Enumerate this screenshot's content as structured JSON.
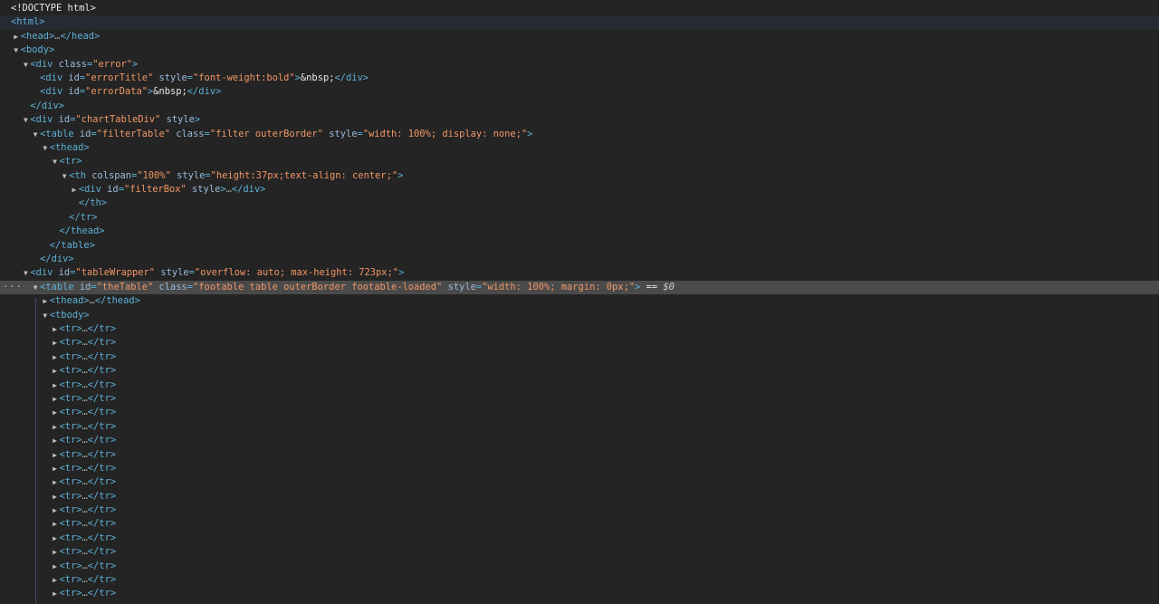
{
  "panel": {
    "name": "Elements"
  },
  "lines": [
    {
      "depth": 0,
      "toggle": "none",
      "segments": [
        {
          "t": "<!DOCTYPE html>",
          "c": "txt"
        }
      ]
    },
    {
      "depth": 0,
      "toggle": "none",
      "row": "hover",
      "segments": [
        {
          "t": "<html>",
          "c": "tag"
        }
      ]
    },
    {
      "depth": 1,
      "toggle": "collapsed",
      "segments": [
        {
          "t": "<head>",
          "c": "tag"
        },
        {
          "t": "…",
          "c": "ell"
        },
        {
          "t": "</head>",
          "c": "tag"
        }
      ]
    },
    {
      "depth": 1,
      "toggle": "expanded",
      "segments": [
        {
          "t": "<body>",
          "c": "tag"
        }
      ]
    },
    {
      "depth": 2,
      "toggle": "expanded",
      "segments": [
        {
          "t": "<div ",
          "c": "tag"
        },
        {
          "t": "class",
          "c": "attr"
        },
        {
          "t": "=",
          "c": "tag"
        },
        {
          "t": "\"error\"",
          "c": "val"
        },
        {
          "t": ">",
          "c": "tag"
        }
      ]
    },
    {
      "depth": 3,
      "toggle": "none",
      "segments": [
        {
          "t": "<div ",
          "c": "tag"
        },
        {
          "t": "id",
          "c": "attr"
        },
        {
          "t": "=",
          "c": "tag"
        },
        {
          "t": "\"errorTitle\"",
          "c": "val"
        },
        {
          "t": " ",
          "c": "tag"
        },
        {
          "t": "style",
          "c": "attr"
        },
        {
          "t": "=",
          "c": "tag"
        },
        {
          "t": "\"font-weight:bold\"",
          "c": "val"
        },
        {
          "t": ">",
          "c": "tag"
        },
        {
          "t": "&nbsp;",
          "c": "txt"
        },
        {
          "t": "</div>",
          "c": "tag"
        }
      ]
    },
    {
      "depth": 3,
      "toggle": "none",
      "segments": [
        {
          "t": "<div ",
          "c": "tag"
        },
        {
          "t": "id",
          "c": "attr"
        },
        {
          "t": "=",
          "c": "tag"
        },
        {
          "t": "\"errorData\"",
          "c": "val"
        },
        {
          "t": ">",
          "c": "tag"
        },
        {
          "t": "&nbsp;",
          "c": "txt"
        },
        {
          "t": "</div>",
          "c": "tag"
        }
      ]
    },
    {
      "depth": 2,
      "toggle": "none",
      "segments": [
        {
          "t": "</div>",
          "c": "tag"
        }
      ]
    },
    {
      "depth": 2,
      "toggle": "expanded",
      "segments": [
        {
          "t": "<div ",
          "c": "tag"
        },
        {
          "t": "id",
          "c": "attr"
        },
        {
          "t": "=",
          "c": "tag"
        },
        {
          "t": "\"chartTableDiv\"",
          "c": "val"
        },
        {
          "t": " ",
          "c": "tag"
        },
        {
          "t": "style",
          "c": "attr"
        },
        {
          "t": ">",
          "c": "tag"
        }
      ]
    },
    {
      "depth": 3,
      "toggle": "expanded",
      "segments": [
        {
          "t": "<table ",
          "c": "tag"
        },
        {
          "t": "id",
          "c": "attr"
        },
        {
          "t": "=",
          "c": "tag"
        },
        {
          "t": "\"filterTable\"",
          "c": "val"
        },
        {
          "t": " ",
          "c": "tag"
        },
        {
          "t": "class",
          "c": "attr"
        },
        {
          "t": "=",
          "c": "tag"
        },
        {
          "t": "\"filter outerBorder\"",
          "c": "val"
        },
        {
          "t": " ",
          "c": "tag"
        },
        {
          "t": "style",
          "c": "attr"
        },
        {
          "t": "=",
          "c": "tag"
        },
        {
          "t": "\"width: 100%; display: none;\"",
          "c": "val"
        },
        {
          "t": ">",
          "c": "tag"
        }
      ]
    },
    {
      "depth": 4,
      "toggle": "expanded",
      "segments": [
        {
          "t": "<thead>",
          "c": "tag"
        }
      ]
    },
    {
      "depth": 5,
      "toggle": "expanded",
      "segments": [
        {
          "t": "<tr>",
          "c": "tag"
        }
      ]
    },
    {
      "depth": 6,
      "toggle": "expanded",
      "segments": [
        {
          "t": "<th ",
          "c": "tag"
        },
        {
          "t": "colspan",
          "c": "attr"
        },
        {
          "t": "=",
          "c": "tag"
        },
        {
          "t": "\"100%\"",
          "c": "val"
        },
        {
          "t": " ",
          "c": "tag"
        },
        {
          "t": "style",
          "c": "attr"
        },
        {
          "t": "=",
          "c": "tag"
        },
        {
          "t": "\"height:37px;text-align: center;\"",
          "c": "val"
        },
        {
          "t": ">",
          "c": "tag"
        }
      ]
    },
    {
      "depth": 7,
      "toggle": "collapsed",
      "segments": [
        {
          "t": "<div ",
          "c": "tag"
        },
        {
          "t": "id",
          "c": "attr"
        },
        {
          "t": "=",
          "c": "tag"
        },
        {
          "t": "\"filterBox\"",
          "c": "val"
        },
        {
          "t": " ",
          "c": "tag"
        },
        {
          "t": "style",
          "c": "attr"
        },
        {
          "t": ">",
          "c": "tag"
        },
        {
          "t": "…",
          "c": "ell"
        },
        {
          "t": "</div>",
          "c": "tag"
        }
      ]
    },
    {
      "depth": 7,
      "toggle": "none",
      "segments": [
        {
          "t": "</th>",
          "c": "tag"
        }
      ]
    },
    {
      "depth": 6,
      "toggle": "none",
      "segments": [
        {
          "t": "</tr>",
          "c": "tag"
        }
      ]
    },
    {
      "depth": 5,
      "toggle": "none",
      "segments": [
        {
          "t": "</thead>",
          "c": "tag"
        }
      ]
    },
    {
      "depth": 4,
      "toggle": "none",
      "segments": [
        {
          "t": "</table>",
          "c": "tag"
        }
      ]
    },
    {
      "depth": 3,
      "toggle": "none",
      "segments": [
        {
          "t": "</div>",
          "c": "tag"
        }
      ]
    },
    {
      "depth": 2,
      "toggle": "expanded",
      "segments": [
        {
          "t": "<div ",
          "c": "tag"
        },
        {
          "t": "id",
          "c": "attr"
        },
        {
          "t": "=",
          "c": "tag"
        },
        {
          "t": "\"tableWrapper\"",
          "c": "val"
        },
        {
          "t": " ",
          "c": "tag"
        },
        {
          "t": "style",
          "c": "attr"
        },
        {
          "t": "=",
          "c": "tag"
        },
        {
          "t": "\"overflow: auto; max-height: 723px;\"",
          "c": "val"
        },
        {
          "t": ">",
          "c": "tag"
        }
      ]
    },
    {
      "depth": 3,
      "toggle": "expanded",
      "row": "selected",
      "dots": "···",
      "segments": [
        {
          "t": "<table ",
          "c": "tag"
        },
        {
          "t": "id",
          "c": "attr"
        },
        {
          "t": "=",
          "c": "tag"
        },
        {
          "t": "\"theTable\"",
          "c": "val"
        },
        {
          "t": " ",
          "c": "tag"
        },
        {
          "t": "class",
          "c": "attr"
        },
        {
          "t": "=",
          "c": "tag"
        },
        {
          "t": "\"footable table outerBorder footable-loaded\"",
          "c": "val"
        },
        {
          "t": " ",
          "c": "tag"
        },
        {
          "t": "style",
          "c": "attr"
        },
        {
          "t": "=",
          "c": "tag"
        },
        {
          "t": "\"width: 100%; margin: 0px;\"",
          "c": "val"
        },
        {
          "t": ">",
          "c": "tag"
        },
        {
          "t": " == ",
          "c": "txt"
        },
        {
          "t": "$0",
          "c": "dollar"
        }
      ]
    },
    {
      "depth": 4,
      "toggle": "collapsed",
      "segments": [
        {
          "t": "<thead>",
          "c": "tag"
        },
        {
          "t": "…",
          "c": "ell"
        },
        {
          "t": "</thead>",
          "c": "tag"
        }
      ]
    },
    {
      "depth": 4,
      "toggle": "expanded",
      "segments": [
        {
          "t": "<tbody>",
          "c": "tag"
        }
      ]
    },
    {
      "depth": 5,
      "toggle": "collapsed",
      "segments": [
        {
          "t": "<tr>",
          "c": "tag"
        },
        {
          "t": "…",
          "c": "ell"
        },
        {
          "t": "</tr>",
          "c": "tag"
        }
      ]
    },
    {
      "depth": 5,
      "toggle": "collapsed",
      "segments": [
        {
          "t": "<tr>",
          "c": "tag"
        },
        {
          "t": "…",
          "c": "ell"
        },
        {
          "t": "</tr>",
          "c": "tag"
        }
      ]
    },
    {
      "depth": 5,
      "toggle": "collapsed",
      "segments": [
        {
          "t": "<tr>",
          "c": "tag"
        },
        {
          "t": "…",
          "c": "ell"
        },
        {
          "t": "</tr>",
          "c": "tag"
        }
      ]
    },
    {
      "depth": 5,
      "toggle": "collapsed",
      "segments": [
        {
          "t": "<tr>",
          "c": "tag"
        },
        {
          "t": "…",
          "c": "ell"
        },
        {
          "t": "</tr>",
          "c": "tag"
        }
      ]
    },
    {
      "depth": 5,
      "toggle": "collapsed",
      "segments": [
        {
          "t": "<tr>",
          "c": "tag"
        },
        {
          "t": "…",
          "c": "ell"
        },
        {
          "t": "</tr>",
          "c": "tag"
        }
      ]
    },
    {
      "depth": 5,
      "toggle": "collapsed",
      "segments": [
        {
          "t": "<tr>",
          "c": "tag"
        },
        {
          "t": "…",
          "c": "ell"
        },
        {
          "t": "</tr>",
          "c": "tag"
        }
      ]
    },
    {
      "depth": 5,
      "toggle": "collapsed",
      "segments": [
        {
          "t": "<tr>",
          "c": "tag"
        },
        {
          "t": "…",
          "c": "ell"
        },
        {
          "t": "</tr>",
          "c": "tag"
        }
      ]
    },
    {
      "depth": 5,
      "toggle": "collapsed",
      "segments": [
        {
          "t": "<tr>",
          "c": "tag"
        },
        {
          "t": "…",
          "c": "ell"
        },
        {
          "t": "</tr>",
          "c": "tag"
        }
      ]
    },
    {
      "depth": 5,
      "toggle": "collapsed",
      "segments": [
        {
          "t": "<tr>",
          "c": "tag"
        },
        {
          "t": "…",
          "c": "ell"
        },
        {
          "t": "</tr>",
          "c": "tag"
        }
      ]
    },
    {
      "depth": 5,
      "toggle": "collapsed",
      "segments": [
        {
          "t": "<tr>",
          "c": "tag"
        },
        {
          "t": "…",
          "c": "ell"
        },
        {
          "t": "</tr>",
          "c": "tag"
        }
      ]
    },
    {
      "depth": 5,
      "toggle": "collapsed",
      "segments": [
        {
          "t": "<tr>",
          "c": "tag"
        },
        {
          "t": "…",
          "c": "ell"
        },
        {
          "t": "</tr>",
          "c": "tag"
        }
      ]
    },
    {
      "depth": 5,
      "toggle": "collapsed",
      "segments": [
        {
          "t": "<tr>",
          "c": "tag"
        },
        {
          "t": "…",
          "c": "ell"
        },
        {
          "t": "</tr>",
          "c": "tag"
        }
      ]
    },
    {
      "depth": 5,
      "toggle": "collapsed",
      "segments": [
        {
          "t": "<tr>",
          "c": "tag"
        },
        {
          "t": "…",
          "c": "ell"
        },
        {
          "t": "</tr>",
          "c": "tag"
        }
      ]
    },
    {
      "depth": 5,
      "toggle": "collapsed",
      "segments": [
        {
          "t": "<tr>",
          "c": "tag"
        },
        {
          "t": "…",
          "c": "ell"
        },
        {
          "t": "</tr>",
          "c": "tag"
        }
      ]
    },
    {
      "depth": 5,
      "toggle": "collapsed",
      "segments": [
        {
          "t": "<tr>",
          "c": "tag"
        },
        {
          "t": "…",
          "c": "ell"
        },
        {
          "t": "</tr>",
          "c": "tag"
        }
      ]
    },
    {
      "depth": 5,
      "toggle": "collapsed",
      "segments": [
        {
          "t": "<tr>",
          "c": "tag"
        },
        {
          "t": "…",
          "c": "ell"
        },
        {
          "t": "</tr>",
          "c": "tag"
        }
      ]
    },
    {
      "depth": 5,
      "toggle": "collapsed",
      "segments": [
        {
          "t": "<tr>",
          "c": "tag"
        },
        {
          "t": "…",
          "c": "ell"
        },
        {
          "t": "</tr>",
          "c": "tag"
        }
      ]
    },
    {
      "depth": 5,
      "toggle": "collapsed",
      "segments": [
        {
          "t": "<tr>",
          "c": "tag"
        },
        {
          "t": "…",
          "c": "ell"
        },
        {
          "t": "</tr>",
          "c": "tag"
        }
      ]
    },
    {
      "depth": 5,
      "toggle": "collapsed",
      "segments": [
        {
          "t": "<tr>",
          "c": "tag"
        },
        {
          "t": "…",
          "c": "ell"
        },
        {
          "t": "</tr>",
          "c": "tag"
        }
      ]
    },
    {
      "depth": 5,
      "toggle": "collapsed",
      "segments": [
        {
          "t": "<tr>",
          "c": "tag"
        },
        {
          "t": "…",
          "c": "ell"
        },
        {
          "t": "</tr>",
          "c": "tag"
        }
      ]
    }
  ],
  "colors": {
    "background": "#242424",
    "tag": "#5db0d7",
    "attribute": "#9bbbdc",
    "value": "#f29766",
    "selected_row": "#4a4a4a",
    "hover_row": "#262a33"
  },
  "icons": {
    "collapsed": "triangle-right-icon",
    "expanded": "triangle-down-icon"
  }
}
